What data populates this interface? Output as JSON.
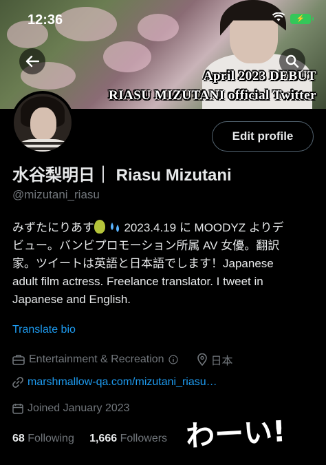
{
  "status_bar": {
    "time": "12:36"
  },
  "banner": {
    "line1": "April 2023 DEBUT",
    "line2": "RIASU MIZUTANI official Twitter"
  },
  "header": {
    "back_icon": "arrow-left-icon",
    "search_icon": "search-icon"
  },
  "profile": {
    "edit_label": "Edit profile",
    "name": "水谷梨明日｜ Riasu Mizutani",
    "handle": "@mizutani_riasu",
    "bio_line1_a": "みずたにりあす",
    "bio_line1_b": "2023.4.19 に MOODYZ よりデ",
    "bio_line2": "ビュー。バンビプロモーション所属 AV 女優。翻訳",
    "bio_line3": "家。ツイートは英語と日本語でします！Japanese",
    "bio_line4": "adult film actress. Freelance translator. I tweet in",
    "bio_line5": "Japanese and English.",
    "translate_label": "Translate bio",
    "category": "Entertainment & Recreation",
    "location": "日本",
    "website": "marshmallow-qa.com/mizutani_riasu…",
    "joined": "Joined January 2023",
    "following_count": "68",
    "following_label": "Following",
    "followers_count": "1,666",
    "followers_label": "Followers"
  },
  "overlay": {
    "text": "わーい!"
  },
  "colors": {
    "accent": "#1d9bf0",
    "muted": "#71767b",
    "background": "#000000"
  }
}
